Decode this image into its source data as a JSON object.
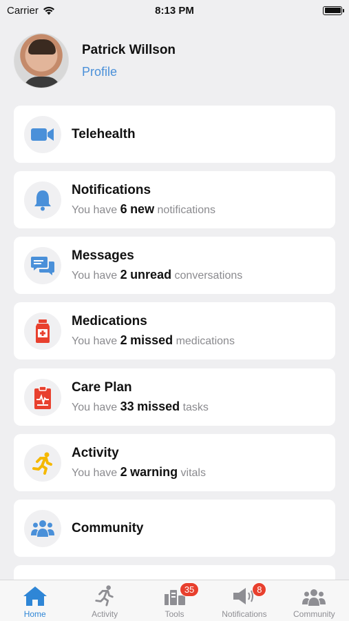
{
  "status_bar": {
    "carrier": "Carrier",
    "time": "8:13 PM"
  },
  "profile": {
    "name": "Patrick Willson",
    "link": "Profile"
  },
  "cards": [
    {
      "title": "Telehealth",
      "icon": "video-camera-icon",
      "color": "#4a90d9"
    },
    {
      "title": "Notifications",
      "prefix": "You have",
      "count": "6",
      "status": "new",
      "suffix": "notifications",
      "icon": "bell-icon",
      "color": "#4a90d9"
    },
    {
      "title": "Messages",
      "prefix": "You have",
      "count": "2",
      "status": "unread",
      "suffix": "conversations",
      "icon": "chat-bubbles-icon",
      "color": "#4a90d9"
    },
    {
      "title": "Medications",
      "prefix": "You have",
      "count": "2",
      "status": "missed",
      "suffix": "medications",
      "icon": "medicine-bottle-icon",
      "color": "#e8402e"
    },
    {
      "title": "Care Plan",
      "prefix": "You have",
      "count": "33",
      "status": "missed",
      "suffix": "tasks",
      "icon": "clipboard-icon",
      "color": "#e8402e"
    },
    {
      "title": "Activity",
      "prefix": "You have",
      "count": "2",
      "status": "warning",
      "suffix": "vitals",
      "icon": "running-person-icon",
      "color": "#f5b800"
    },
    {
      "title": "Community",
      "icon": "people-group-icon",
      "color": "#4a90d9"
    }
  ],
  "tabs": [
    {
      "label": "Home",
      "icon": "house-icon",
      "active": true
    },
    {
      "label": "Activity",
      "icon": "running-person-icon"
    },
    {
      "label": "Tools",
      "icon": "tools-icon",
      "badge": "35"
    },
    {
      "label": "Notifications",
      "icon": "megaphone-icon",
      "badge": "8"
    },
    {
      "label": "Community",
      "icon": "people-group-icon"
    }
  ],
  "colors": {
    "accent": "#2f86d6",
    "warning": "#f5b800",
    "danger": "#e8402e"
  }
}
